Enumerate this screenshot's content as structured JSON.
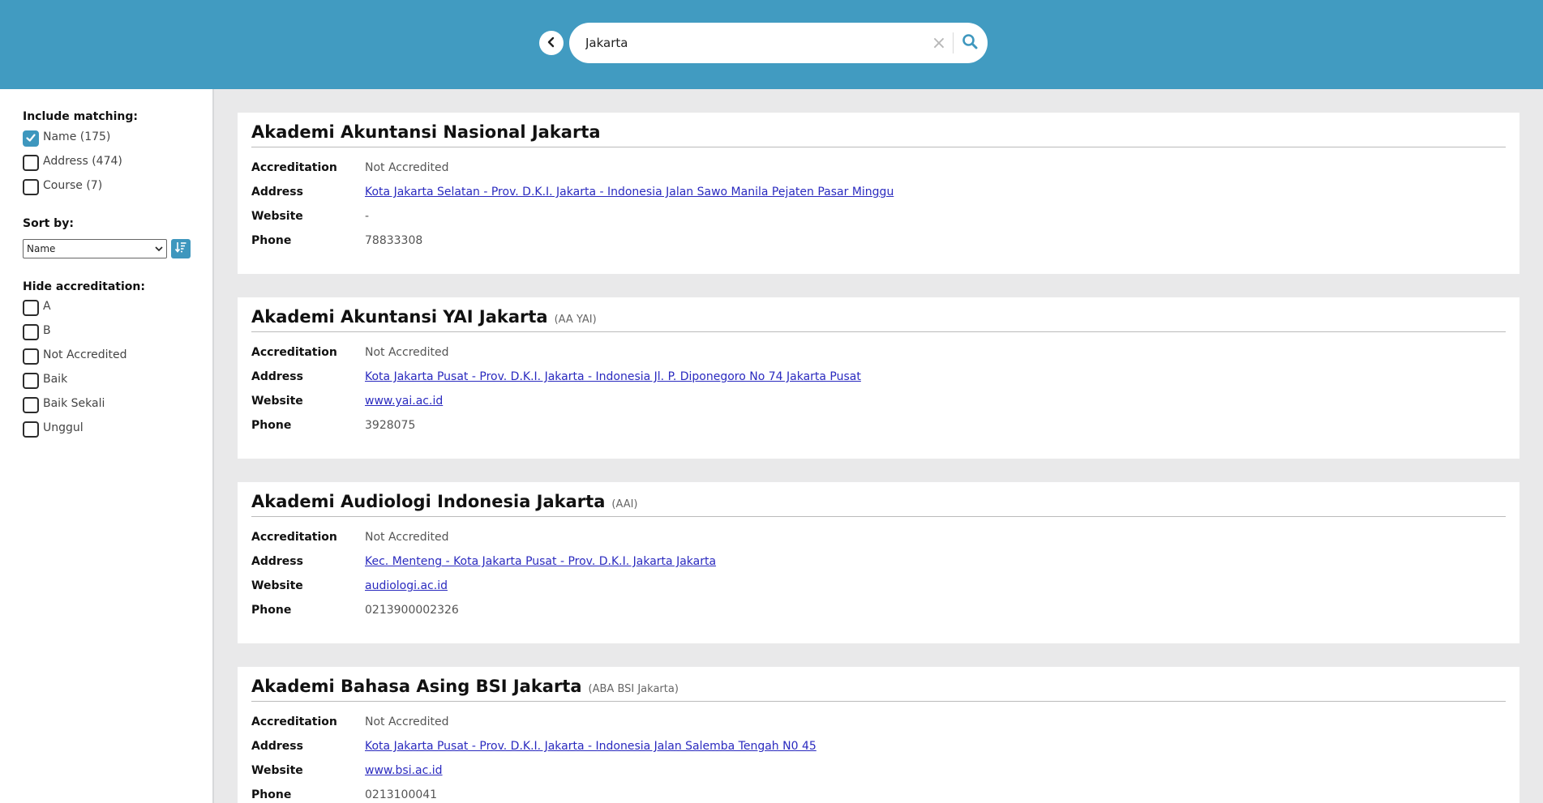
{
  "search": {
    "query": "Jakarta"
  },
  "filters": {
    "include_heading": "Include matching:",
    "include": [
      {
        "label": "Name (175)",
        "checked": true
      },
      {
        "label": "Address (474)",
        "checked": false
      },
      {
        "label": "Course (7)",
        "checked": false
      }
    ],
    "sort_heading": "Sort by:",
    "sort_value": "Name",
    "hide_heading": "Hide accreditation:",
    "hide": [
      {
        "label": "A",
        "checked": false
      },
      {
        "label": "B",
        "checked": false
      },
      {
        "label": "Not Accredited",
        "checked": false
      },
      {
        "label": "Baik",
        "checked": false
      },
      {
        "label": "Baik Sekali",
        "checked": false
      },
      {
        "label": "Unggul",
        "checked": false
      }
    ]
  },
  "field_labels": {
    "accreditation": "Accreditation",
    "address": "Address",
    "website": "Website",
    "phone": "Phone"
  },
  "results": [
    {
      "name": "Akademi Akuntansi Nasional Jakarta",
      "abbr": "",
      "accreditation": "Not Accredited",
      "address": "Kota Jakarta Selatan - Prov. D.K.I. Jakarta - Indonesia Jalan Sawo Manila Pejaten Pasar Minggu",
      "website": "-",
      "phone": "78833308"
    },
    {
      "name": "Akademi Akuntansi YAI Jakarta",
      "abbr": "(AA YAI)",
      "accreditation": "Not Accredited",
      "address": "Kota Jakarta Pusat - Prov. D.K.I. Jakarta - Indonesia Jl. P. Diponegoro No 74 Jakarta Pusat",
      "website": "www.yai.ac.id",
      "phone": "3928075"
    },
    {
      "name": "Akademi Audiologi Indonesia Jakarta",
      "abbr": "(AAI)",
      "accreditation": "Not Accredited",
      "address": "Kec. Menteng - Kota Jakarta Pusat - Prov. D.K.I. Jakarta Jakarta",
      "website": "audiologi.ac.id",
      "phone": "0213900002326"
    },
    {
      "name": "Akademi Bahasa Asing BSI Jakarta",
      "abbr": "(ABA BSI Jakarta)",
      "accreditation": "Not Accredited",
      "address": "Kota Jakarta Pusat - Prov. D.K.I. Jakarta - Indonesia Jalan Salemba Tengah N0 45",
      "website": "www.bsi.ac.id",
      "phone": "0213100041"
    }
  ],
  "colors": {
    "header": "#419bc1",
    "accent": "#3e97be",
    "link": "#2a2abf",
    "page_bg": "#e9e9ea"
  },
  "icons": {
    "back": "chevron-left-icon",
    "clear": "close-icon",
    "search": "search-icon",
    "sort_direction": "sort-descending-icon",
    "checked": "checkmark-icon"
  }
}
